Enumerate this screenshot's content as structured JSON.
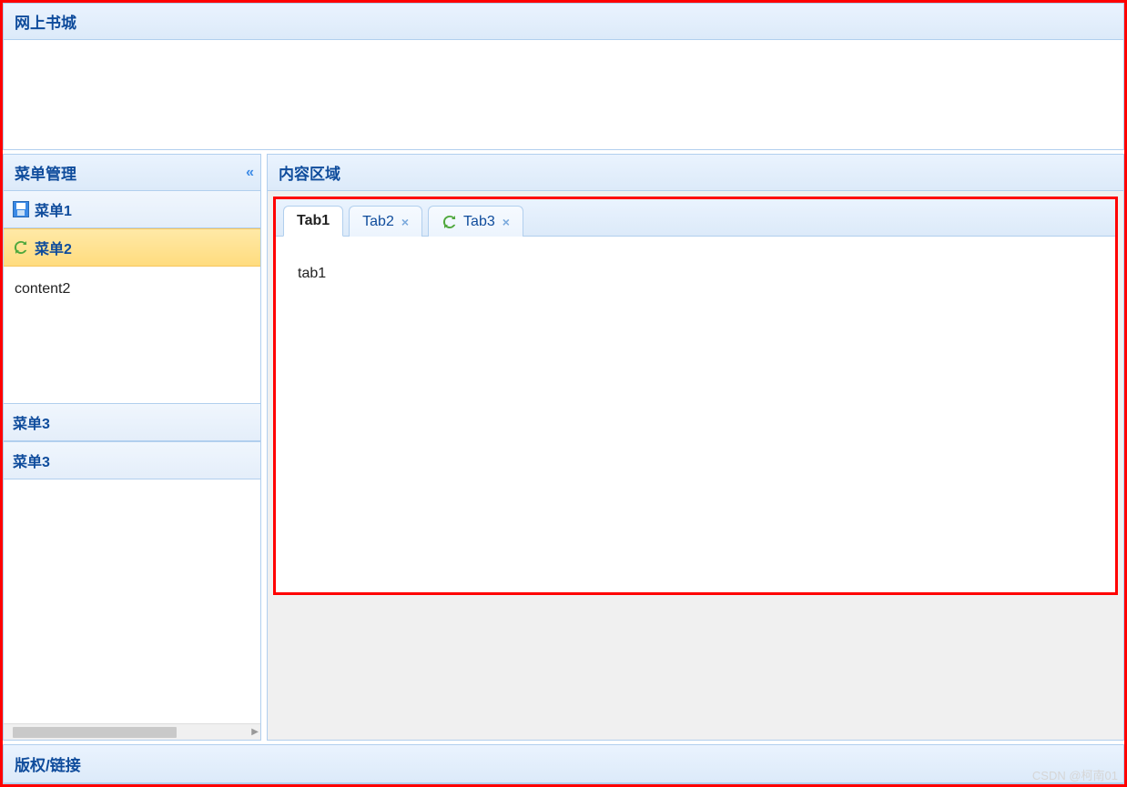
{
  "header": {
    "title": "网上书城"
  },
  "sidebar": {
    "title": "菜单管理",
    "items": [
      {
        "label": "菜单1",
        "icon": "save-icon"
      },
      {
        "label": "菜单2",
        "icon": "reload-icon",
        "selected": true,
        "content": "content2"
      },
      {
        "label": "菜单3"
      },
      {
        "label": "菜单3"
      }
    ]
  },
  "main": {
    "title": "内容区域",
    "tabs": [
      {
        "label": "Tab1",
        "active": true,
        "closable": false,
        "icon": null
      },
      {
        "label": "Tab2",
        "active": false,
        "closable": true,
        "icon": null
      },
      {
        "label": "Tab3",
        "active": false,
        "closable": true,
        "icon": "reload-icon"
      }
    ],
    "active_tab_content": "tab1"
  },
  "footer": {
    "title": "版权/链接"
  },
  "watermark": "CSDN @柯南01"
}
